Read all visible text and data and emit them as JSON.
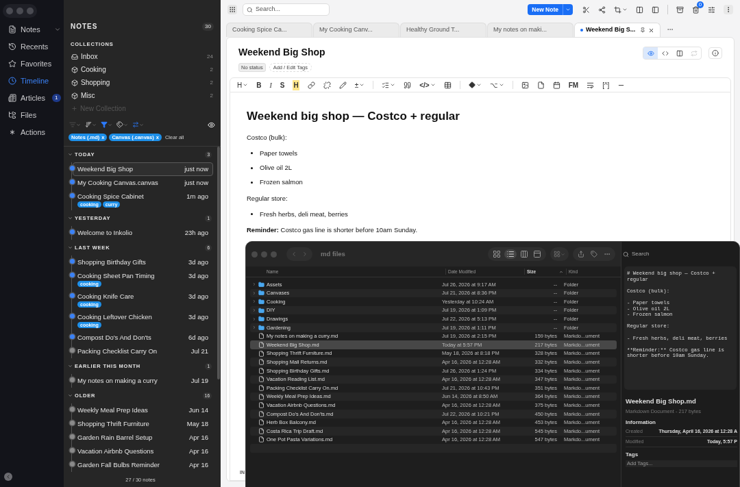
{
  "nav": {
    "items": [
      {
        "label": "Notes",
        "selected": false,
        "expandable": true
      },
      {
        "label": "Recents",
        "selected": false
      },
      {
        "label": "Favorites",
        "selected": false
      },
      {
        "label": "Timeline",
        "selected": true
      },
      {
        "label": "Articles",
        "selected": false,
        "badge": "1"
      },
      {
        "label": "Files",
        "selected": false
      },
      {
        "label": "Actions",
        "selected": false
      }
    ]
  },
  "notes_panel": {
    "title": "NOTES",
    "count": "30",
    "collections_heading": "COLLECTIONS",
    "collections": [
      {
        "label": "Inbox",
        "count": "24"
      },
      {
        "label": "Cooking",
        "count": "2"
      },
      {
        "label": "Shopping",
        "count": "2"
      },
      {
        "label": "Misc",
        "count": "2"
      }
    ],
    "new_collection": "New Collection",
    "filters": [
      {
        "label": "Notes (.md)",
        "remove": "x"
      },
      {
        "label": "Canvas (.canvas)",
        "remove": "x"
      }
    ],
    "clear_filters": "Clear all",
    "groups": [
      {
        "label": "TODAY",
        "count": "3",
        "notes": [
          {
            "title": "Weekend Big Shop",
            "time": "just now",
            "selected": true,
            "color": "#3b82f6"
          },
          {
            "title": "My Cooking Canvas.canvas",
            "time": "just now",
            "selected": false,
            "color": "#3b82f6"
          },
          {
            "title": "Cooking Spice Cabinet",
            "time": "1m ago",
            "selected": false,
            "color": "#3b82f6",
            "tags": [
              "cooking",
              "curry"
            ]
          }
        ]
      },
      {
        "label": "YESTERDAY",
        "count": "1",
        "notes": [
          {
            "title": "Welcome to Inkolio",
            "time": "23h ago",
            "selected": false,
            "color": "#3b82f6"
          }
        ]
      },
      {
        "label": "LAST WEEK",
        "count": "6",
        "notes": [
          {
            "title": "Shopping Birthday Gifts",
            "time": "3d ago",
            "selected": false,
            "color": "#3b82f6"
          },
          {
            "title": "Cooking Sheet Pan Timing",
            "time": "3d ago",
            "selected": false,
            "color": "#3b82f6",
            "tags": [
              "cooking"
            ]
          },
          {
            "title": "Cooking Knife Care",
            "time": "3d ago",
            "selected": false,
            "color": "#3b82f6",
            "tags": [
              "cooking"
            ]
          },
          {
            "title": "Cooking Leftover Chicken",
            "time": "3d ago",
            "selected": false,
            "color": "#3b82f6",
            "tags": [
              "cooking"
            ]
          },
          {
            "title": "Compost Do's And Don'ts",
            "time": "6d ago",
            "selected": false,
            "color": "#3b82f6"
          },
          {
            "title": "Packing Checklist Carry On",
            "time": "Jul 21",
            "selected": false,
            "color": "#8a8a8a"
          }
        ]
      },
      {
        "label": "EARLIER THIS MONTH",
        "count": "1",
        "notes": [
          {
            "title": "My notes on making a curry",
            "time": "Jul 19",
            "selected": false,
            "color": "#8a8a8a"
          }
        ]
      },
      {
        "label": "OLDER",
        "count": "16",
        "notes": [
          {
            "title": "Weekly Meal Prep Ideas",
            "time": "Jun 14",
            "selected": false,
            "color": "#8a8a8a"
          },
          {
            "title": "Shopping Thrift Furniture",
            "time": "May 18",
            "selected": false,
            "color": "#8a8a8a"
          },
          {
            "title": "Garden Rain Barrel Setup",
            "time": "Apr 16",
            "selected": false,
            "color": "#8a8a8a"
          },
          {
            "title": "Vacation Airbnb Questions",
            "time": "Apr 16",
            "selected": false,
            "color": "#8a8a8a"
          },
          {
            "title": "Garden Fall Bulbs Reminder",
            "time": "Apr 16",
            "selected": false,
            "color": "#8a8a8a"
          }
        ]
      }
    ],
    "footer": "27 / 30 notes"
  },
  "topbar": {
    "search_placeholder": "Search...",
    "new_note": "New Note",
    "trash_badge": "0"
  },
  "tabs": [
    {
      "label": "Cooking Spice Ca...",
      "selected": false
    },
    {
      "label": "My Cooking Canv...",
      "selected": false
    },
    {
      "label": "Healthy Ground T...",
      "selected": false
    },
    {
      "label": "My notes on maki...",
      "selected": false
    },
    {
      "label": "Weekend Big S...",
      "selected": true,
      "pinned": true,
      "unsaved": true
    }
  ],
  "note": {
    "title": "Weekend Big Shop",
    "status": "No status",
    "tags_button": "Add / Edit Tags",
    "view_modes": [
      {
        "selected": true
      },
      {
        "selected": false
      },
      {
        "selected": false
      },
      {
        "selected": false,
        "disabled": true
      }
    ],
    "toolbar": {
      "heading": "H",
      "bold": "B",
      "italic": "I",
      "strike": "S",
      "highlight": "H",
      "plusminus": "±",
      "code": "</>",
      "option": "⌥",
      "frontmatter": "FM",
      "footnote": "[^]"
    },
    "heading": "Weekend big shop — Costco + regular",
    "blocks": [
      {
        "kind": "p",
        "text": "Costco (bulk):"
      },
      {
        "kind": "ul",
        "items": [
          "Paper towels",
          "Olive oil 2L",
          "Frozen salmon"
        ]
      },
      {
        "kind": "p",
        "text": "Regular store:"
      },
      {
        "kind": "ul",
        "items": [
          "Fresh herbs, deli meat, berries"
        ]
      },
      {
        "kind": "p",
        "text": "**Reminder:** Costco gas line is shorter before 10am Sunday."
      }
    ],
    "footer_label": "IN"
  },
  "finder": {
    "title": "md files",
    "search": "Search",
    "columns": [
      {
        "label": "Name",
        "sorted": false
      },
      {
        "label": "Date Modified",
        "sorted": false
      },
      {
        "label": "Size",
        "sorted": true
      },
      {
        "label": "Kind",
        "sorted": false
      }
    ],
    "rows": [
      {
        "kind": "folder",
        "name": "Assets",
        "date": "Jul 26, 2026 at 9:17 AM",
        "size": "--",
        "type": "Folder",
        "selected": false
      },
      {
        "kind": "folder",
        "name": "Canvases",
        "date": "Jul 21, 2026 at 8:36 PM",
        "size": "--",
        "type": "Folder",
        "selected": false
      },
      {
        "kind": "folder",
        "name": "Cooking",
        "date": "Yesterday at 10:24 AM",
        "size": "--",
        "type": "Folder",
        "selected": false
      },
      {
        "kind": "folder",
        "name": "DIY",
        "date": "Jul 19, 2026 at 1:09 PM",
        "size": "--",
        "type": "Folder",
        "selected": false
      },
      {
        "kind": "folder",
        "name": "Drawings",
        "date": "Jul 22, 2026 at 5:13 PM",
        "size": "--",
        "type": "Folder",
        "selected": false
      },
      {
        "kind": "folder",
        "name": "Gardening",
        "date": "Jul 19, 2026 at 1:11 PM",
        "size": "--",
        "type": "Folder",
        "selected": false
      },
      {
        "kind": "file",
        "name": "My notes on making a curry.md",
        "date": "Jul 19, 2026 at 2:15 PM",
        "size": "159 bytes",
        "type": "Markdo...ument",
        "selected": false
      },
      {
        "kind": "file",
        "name": "Weekend Big Shop.md",
        "date": "Today at 5:57 PM",
        "size": "217 bytes",
        "type": "Markdo...ument",
        "selected": true
      },
      {
        "kind": "file",
        "name": "Shopping Thrift Furniture.md",
        "date": "May 18, 2026 at 8:18 PM",
        "size": "328 bytes",
        "type": "Markdo...ument",
        "selected": false
      },
      {
        "kind": "file",
        "name": "Shopping Mall Returns.md",
        "date": "Apr 16, 2026 at 12:28 AM",
        "size": "332 bytes",
        "type": "Markdo...ument",
        "selected": false
      },
      {
        "kind": "file",
        "name": "Shopping Birthday Gifts.md",
        "date": "Jul 26, 2026 at 1:24 PM",
        "size": "334 bytes",
        "type": "Markdo...ument",
        "selected": false
      },
      {
        "kind": "file",
        "name": "Vacation Reading List.md",
        "date": "Apr 16, 2026 at 12:28 AM",
        "size": "347 bytes",
        "type": "Markdo...ument",
        "selected": false
      },
      {
        "kind": "file",
        "name": "Packing Checklist Carry On.md",
        "date": "Jul 21, 2026 at 10:43 PM",
        "size": "351 bytes",
        "type": "Markdo...ument",
        "selected": false
      },
      {
        "kind": "file",
        "name": "Weekly Meal Prep Ideas.md",
        "date": "Jun 14, 2026 at 8:50 AM",
        "size": "364 bytes",
        "type": "Markdo...ument",
        "selected": false
      },
      {
        "kind": "file",
        "name": "Vacation Airbnb Questions.md",
        "date": "Apr 16, 2026 at 12:28 AM",
        "size": "375 bytes",
        "type": "Markdo...ument",
        "selected": false
      },
      {
        "kind": "file",
        "name": "Compost Do's And Don'ts.md",
        "date": "Jul 22, 2026 at 10:21 PM",
        "size": "450 bytes",
        "type": "Markdo...ument",
        "selected": false
      },
      {
        "kind": "file",
        "name": "Herb Box Balcony.md",
        "date": "Apr 16, 2026 at 12:28 AM",
        "size": "453 bytes",
        "type": "Markdo...ument",
        "selected": false
      },
      {
        "kind": "file",
        "name": "Costa Rica Trip Draft.md",
        "date": "Apr 16, 2026 at 12:28 AM",
        "size": "545 bytes",
        "type": "Markdo...ument",
        "selected": false
      },
      {
        "kind": "file",
        "name": "One Pot Pasta Variations.md",
        "date": "Apr 16, 2026 at 12:28 AM",
        "size": "547 bytes",
        "type": "Markdo...ument",
        "selected": false
      }
    ],
    "preview": {
      "source": "# Weekend big shop — Costco +\nregular\n\nCostco (bulk):\n\n- Paper towels\n- Olive oil 2L\n- Frozen salmon\n\nRegular store:\n\n- Fresh herbs, deli meat, berries\n\n**Reminder:** Costco gas line is\nshorter before 10am Sunday.",
      "filename": "Weekend Big Shop.md",
      "subtitle": "Markdown Document - 217 bytes",
      "info_heading": "Information",
      "info": [
        {
          "label": "Created",
          "value": "Thursday, April 16, 2026 at 12:28 A"
        },
        {
          "label": "Modified",
          "value": "Today, 5:57 P"
        }
      ],
      "tags_heading": "Tags",
      "tags_placeholder": "Add Tags..."
    }
  }
}
